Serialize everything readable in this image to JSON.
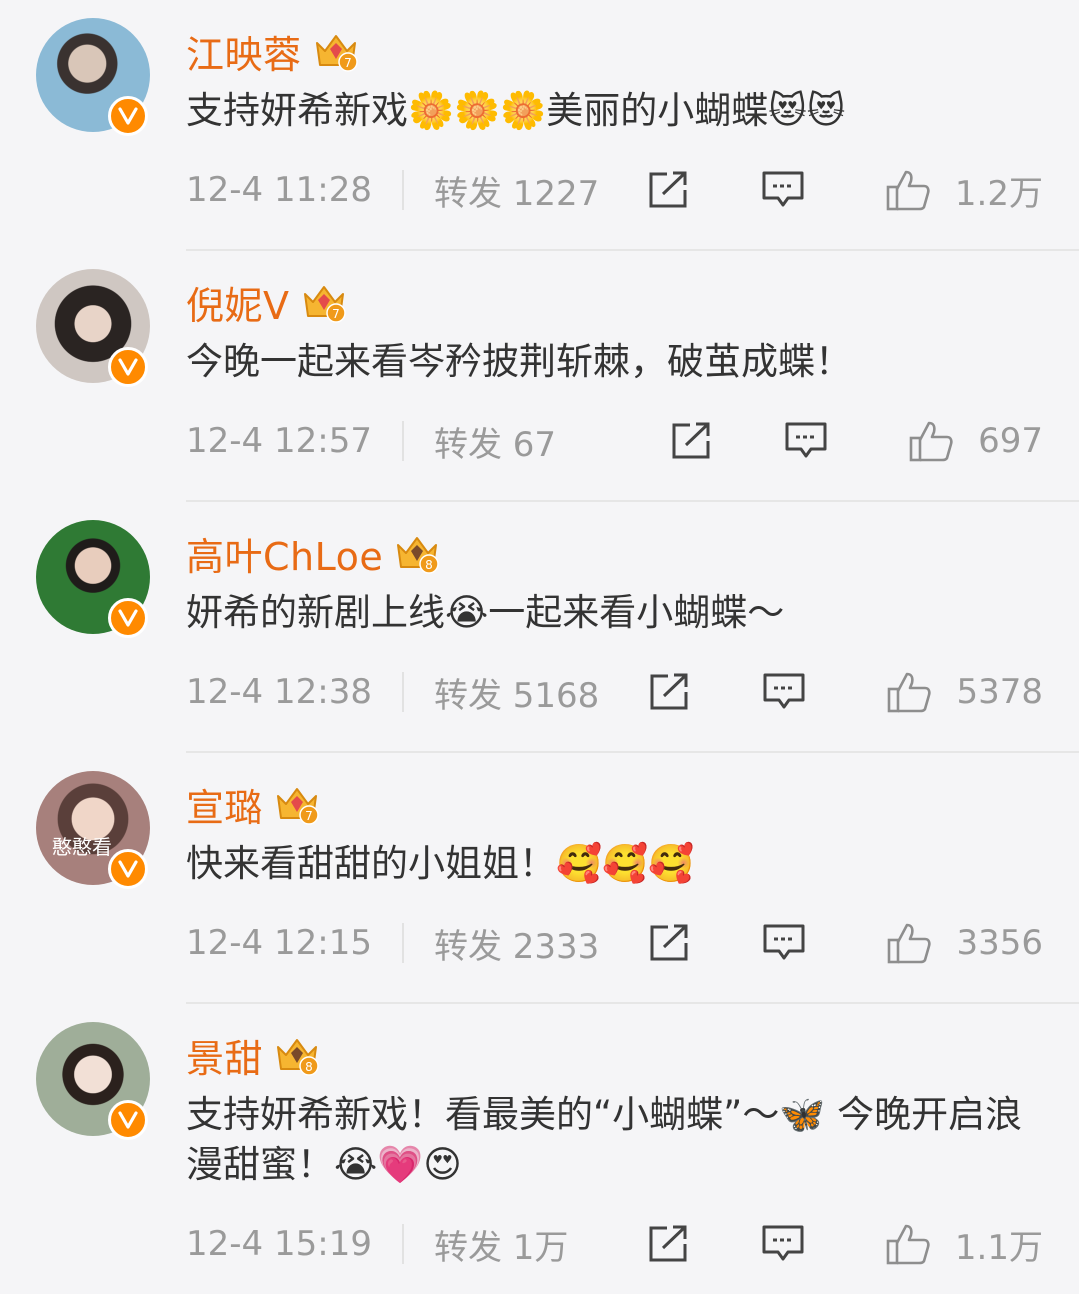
{
  "posts": [
    {
      "username": "江映蓉",
      "text": "支持妍希新戏🌼🌼🌼美丽的小蝴蝶😻😻",
      "time": "12-4 11:28",
      "repost": "转发 1227",
      "likes": "1.2万",
      "avatar_color": "#6aa4c8"
    },
    {
      "username": "倪妮V",
      "text": "今晚一起来看岑矜披荆斩棘，破茧成蝶！",
      "time": "12-4 12:57",
      "repost": "转发 67",
      "likes": "697",
      "avatar_color": "#5a4a44"
    },
    {
      "username": "高叶ChLoe",
      "text": "妍希的新剧上线😭一起来看小蝴蝶～",
      "time": "12-4 12:38",
      "repost": "转发 5168",
      "likes": "5378",
      "avatar_color": "#3f7d3c"
    },
    {
      "username": "宣璐",
      "text": "快来看甜甜的小姐姐！🥰🥰🥰",
      "time": "12-4 12:15",
      "repost": "转发 2333",
      "likes": "3356",
      "avatar_color": "#b08a86",
      "avatar_text": "憨憨看"
    },
    {
      "username": "景甜",
      "text": "支持妍希新戏！看最美的“小蝴蝶”～🦋 今晚开启浪漫甜蜜！😭💗😍",
      "time": "12-4 15:19",
      "repost": "转发 1万",
      "likes": "1.1万",
      "avatar_color": "#7d8f7a"
    }
  ],
  "colors": {
    "username": "#e86b15",
    "badge": "#ff8a00",
    "meta": "#9a9a9a",
    "background": "#f5f5f7"
  },
  "icons": [
    "verified-v-icon",
    "crown-badge-icon",
    "share-icon",
    "comment-icon",
    "like-icon"
  ]
}
